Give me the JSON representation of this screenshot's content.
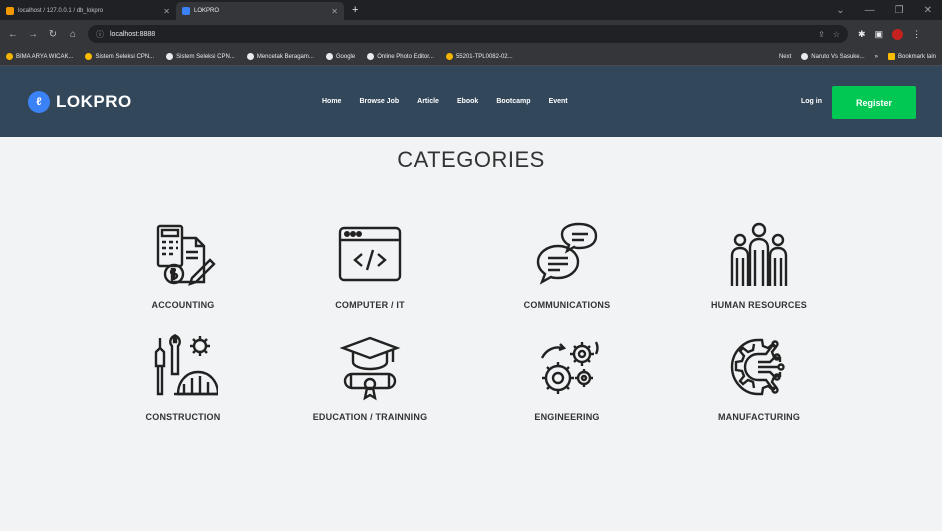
{
  "browser": {
    "tabs": [
      {
        "title": "localhost / 127.0.0.1 / db_lokpro"
      },
      {
        "title": "LOKPRO"
      }
    ],
    "url": "localhost:8888",
    "bookmarks": [
      "BIMA ARYA WICAK...",
      "Sistem Seleksi CPN...",
      "Sistem Seleksi CPN...",
      "Mencetak Beragam...",
      "Google",
      "Online Photo Editor...",
      "55201-TPL0082-02..."
    ],
    "bookmarks_right": [
      "Next",
      "Naruto Vs Sasuke...",
      "Bookmark lain"
    ]
  },
  "site": {
    "brand": "LOKPRO",
    "nav": [
      "Home",
      "Browse Job",
      "Article",
      "Ebook",
      "Bootcamp",
      "Event"
    ],
    "login": "Log in",
    "register": "Register"
  },
  "categories": {
    "title": "CATEGORIES",
    "items": [
      {
        "label": "ACCOUNTING",
        "icon": "accounting-icon"
      },
      {
        "label": "COMPUTER / IT",
        "icon": "computer-code-icon"
      },
      {
        "label": "COMMUNICATIONS",
        "icon": "chat-bubbles-icon"
      },
      {
        "label": "HUMAN RESOURCES",
        "icon": "people-group-icon"
      },
      {
        "label": "CONSTRUCTION",
        "icon": "tools-helmet-icon"
      },
      {
        "label": "EDUCATION / TRAINNING",
        "icon": "graduation-cap-icon"
      },
      {
        "label": "ENGINEERING",
        "icon": "gears-icon"
      },
      {
        "label": "MANUFACTURING",
        "icon": "gear-circuit-icon"
      }
    ]
  },
  "colors": {
    "header_bg": "#33475b",
    "register_bg": "#00c853",
    "page_bg": "#f1f3f4"
  }
}
